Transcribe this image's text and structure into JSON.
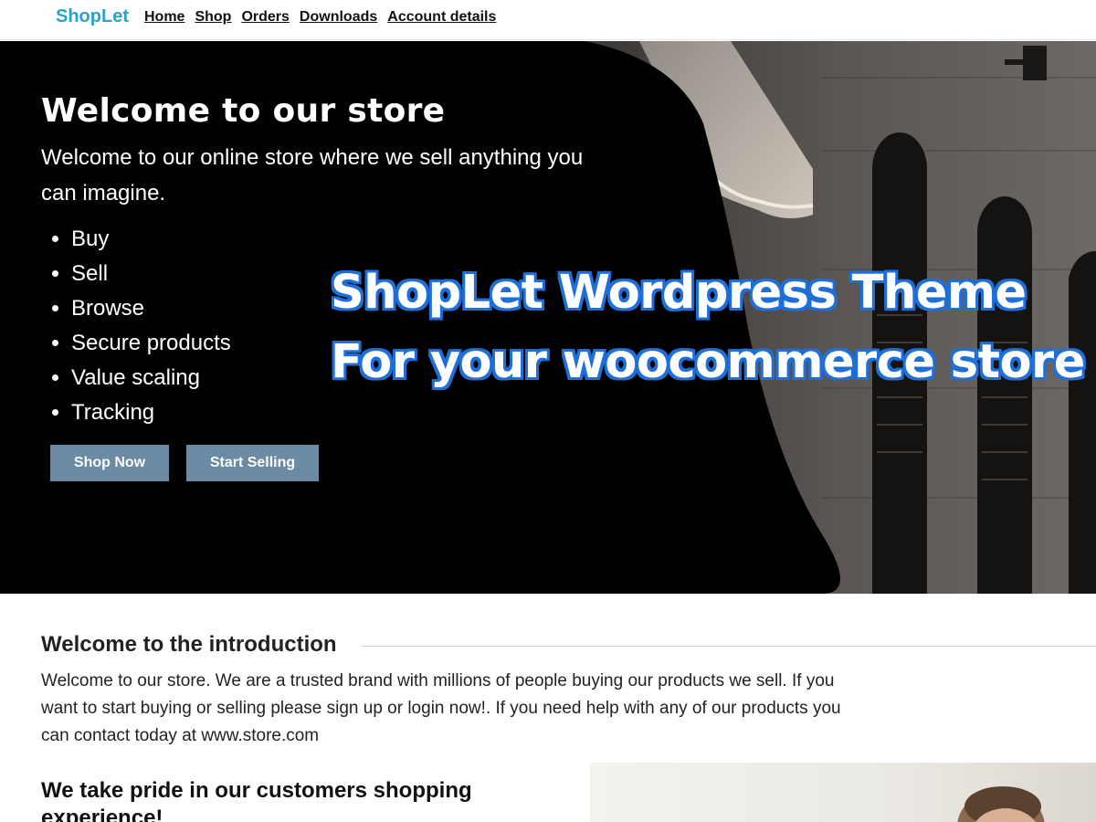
{
  "header": {
    "brand": "ShopLet",
    "nav": [
      "Home",
      "Shop",
      "Orders",
      "Downloads",
      "Account details"
    ]
  },
  "hero": {
    "title": "Welcome to our store",
    "subtitle": "Welcome to our online store where we sell anything you can imagine.",
    "features": [
      "Buy",
      "Sell",
      "Browse",
      "Secure products",
      "Value scaling",
      "Tracking"
    ],
    "buttons": {
      "shop_now": "Shop Now",
      "start_selling": "Start Selling"
    },
    "overlay_line1": "ShopLet Wordpress Theme",
    "overlay_line2": "For your woocommerce store"
  },
  "intro": {
    "heading": "Welcome to the introduction",
    "body": "Welcome to our store. We are a trusted brand with millions of people buying our products we sell. If you want to start buying or selling please sign up or login now!. If you need help with any of our products you can contact today at www.store.com"
  },
  "pride": {
    "heading": "We take pride in our customers shopping experience!"
  },
  "colors": {
    "brand": "#2aa3c9",
    "button": "#6b8aa3",
    "overlay_outline": "#1e6fd9",
    "hero_bg": "#000000"
  }
}
